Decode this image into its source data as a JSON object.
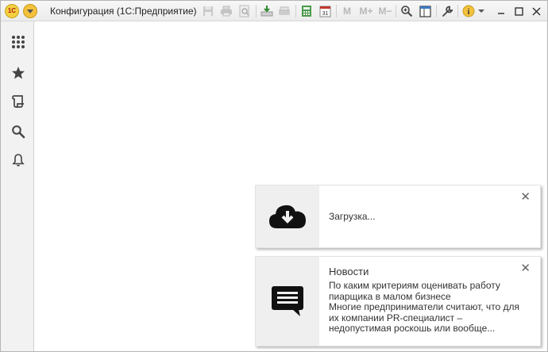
{
  "window": {
    "title": "Конфигурация  (1С:Предприятие)"
  },
  "toolbar": {
    "m_label": "M",
    "m_plus_label": "M+",
    "m_minus_label": "M−",
    "calendar_day": "31"
  },
  "notifications": [
    {
      "icon": "cloud-download-icon",
      "message": "Загрузка..."
    },
    {
      "icon": "chat-news-icon",
      "title": "Новости",
      "lines": [
        "По каким критериям оценивать работу",
        "пиарщика в малом бизнесе",
        "Многие предприниматели считают, что для",
        "их компании PR-специалист –",
        "недопустимая роскошь или вообще..."
      ]
    }
  ],
  "sidebar": {
    "items": [
      "apps-grid-icon",
      "favorites-star-icon",
      "history-scroll-icon",
      "search-icon",
      "notifications-bell-icon"
    ]
  }
}
